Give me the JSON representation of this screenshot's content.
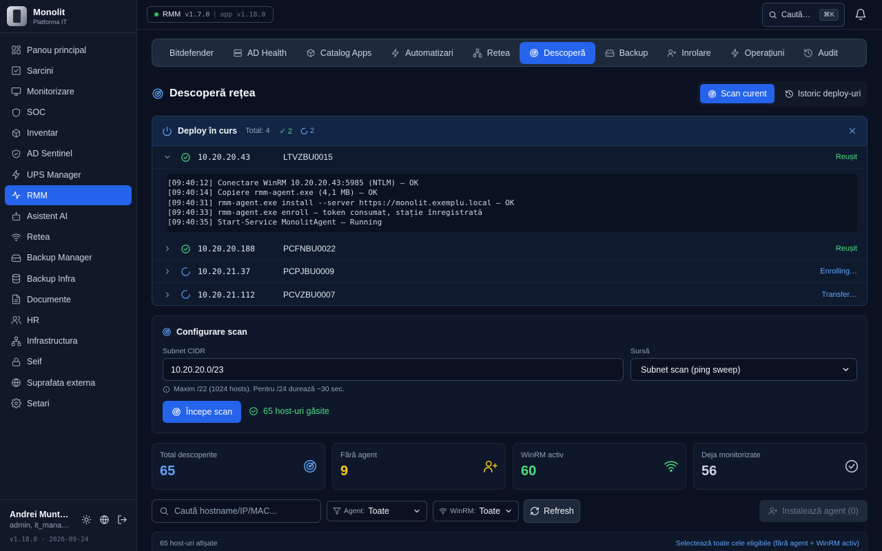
{
  "brand": {
    "name": "Monolit",
    "subtitle": "Platforma IT"
  },
  "sidebar": {
    "items": [
      {
        "label": "Panou principal",
        "icon": "dashboard-icon"
      },
      {
        "label": "Sarcini",
        "icon": "checkbox-icon"
      },
      {
        "label": "Monitorizare",
        "icon": "monitor-icon"
      },
      {
        "label": "SOC",
        "icon": "shield-icon"
      },
      {
        "label": "Inventar",
        "icon": "box-icon"
      },
      {
        "label": "AD Sentinel",
        "icon": "shield-check-icon"
      },
      {
        "label": "UPS Manager",
        "icon": "bolt-icon"
      },
      {
        "label": "RMM",
        "icon": "activity-icon",
        "active": true
      },
      {
        "label": "Asistent AI",
        "icon": "bot-icon"
      },
      {
        "label": "Retea",
        "icon": "wifi-icon"
      },
      {
        "label": "Backup Manager",
        "icon": "hard-drive-icon"
      },
      {
        "label": "Backup Infra",
        "icon": "database-icon"
      },
      {
        "label": "Documente",
        "icon": "document-icon"
      },
      {
        "label": "HR",
        "icon": "users-icon"
      },
      {
        "label": "Infrastructura",
        "icon": "network-icon"
      },
      {
        "label": "Seif",
        "icon": "lock-icon"
      },
      {
        "label": "Suprafata externa",
        "icon": "globe-icon"
      },
      {
        "label": "Setari",
        "icon": "gear-icon"
      }
    ]
  },
  "user": {
    "name": "Andrei Munt…",
    "role": "admin, it_mana…",
    "version": "v1.18.0 · 2026-09-24"
  },
  "topbar": {
    "module": "RMM",
    "module_version": "v1.7.0",
    "separator": "|",
    "app_version": "app v1.18.0",
    "search_label": "Caută…",
    "search_shortcut": "⌘K"
  },
  "tabs": [
    {
      "label": "Bitdefender",
      "icon": "shield-icon"
    },
    {
      "label": "AD Health",
      "icon": "server-icon"
    },
    {
      "label": "Catalog Apps",
      "icon": "box-icon"
    },
    {
      "label": "Automatizari",
      "icon": "bolt-icon"
    },
    {
      "label": "Retea",
      "icon": "network-icon"
    },
    {
      "label": "Descoperă",
      "icon": "radar-icon",
      "active": true
    },
    {
      "label": "Backup",
      "icon": "hard-drive-icon"
    },
    {
      "label": "Inrolare",
      "icon": "user-plus-icon"
    },
    {
      "label": "Operațiuni",
      "icon": "bolt-icon"
    },
    {
      "label": "Audit",
      "icon": "history-icon"
    }
  ],
  "page": {
    "title": "Descoperă rețea",
    "view_current": "Scan curent",
    "view_history": "Istoric deploy-uri"
  },
  "deploy": {
    "title": "Deploy în curs",
    "total": "Total: 4",
    "ok_count": "✓ 2",
    "running_count": "2",
    "rows": [
      {
        "ip": "10.20.20.43",
        "host": "LTVZBU0015",
        "status": "Reușit",
        "state": "ok",
        "expanded": true
      },
      {
        "ip": "10.20.20.188",
        "host": "PCFNBU0022",
        "status": "Reușit",
        "state": "ok"
      },
      {
        "ip": "10.20.21.37",
        "host": "PCPJBU0009",
        "status": "Enrolling…",
        "state": "run"
      },
      {
        "ip": "10.20.21.112",
        "host": "PCVZBU0007",
        "status": "Transfer…",
        "state": "run"
      }
    ],
    "log": [
      "[09:40:12] Conectare WinRM 10.20.20.43:5985 (NTLM) — OK",
      "[09:40:14] Copiere rmm-agent.exe (4,1 MB) — OK",
      "[09:40:31] rmm-agent.exe install --server https://monolit.exemplu.local — OK",
      "[09:40:33] rmm-agent.exe enroll — token consumat, stație înregistrată",
      "[09:40:35] Start-Service MonolitAgent — Running"
    ]
  },
  "config": {
    "title": "Configurare scan",
    "subnet_label": "Subnet CIDR",
    "subnet_value": "10.20.20.0/23",
    "source_label": "Sursă",
    "source_value": "Subnet scan (ping sweep)",
    "hint": "Maxim /22 (1024 hosts). Pentru /24 durează ~30 sec.",
    "start_label": "Începe scan",
    "found_label": "65 host-uri găsite"
  },
  "stats": [
    {
      "label": "Total descoperite",
      "value": "65",
      "color": "#60a5fa",
      "icon": "radar-icon"
    },
    {
      "label": "Fără agent",
      "value": "9",
      "color": "#facc15",
      "icon": "user-plus-icon"
    },
    {
      "label": "WinRM activ",
      "value": "60",
      "color": "#4ade80",
      "icon": "wifi-icon"
    },
    {
      "label": "Deja monitorizate",
      "value": "56",
      "color": "#cbd5e1",
      "icon": "check-circle-icon"
    }
  ],
  "filters": {
    "search_placeholder": "Caută hostname/IP/MAC...",
    "agent_label": "Agent:",
    "agent_value": "Toate",
    "winrm_label": "WinRM:",
    "winrm_value": "Toate",
    "refresh_label": "Refresh",
    "install_label": "Instalează agent (0)"
  },
  "hosts": {
    "count_label": "65 host-uri afișate",
    "select_all_label": "Selectează toate cele eligibile (fără agent + WinRM activ)"
  }
}
